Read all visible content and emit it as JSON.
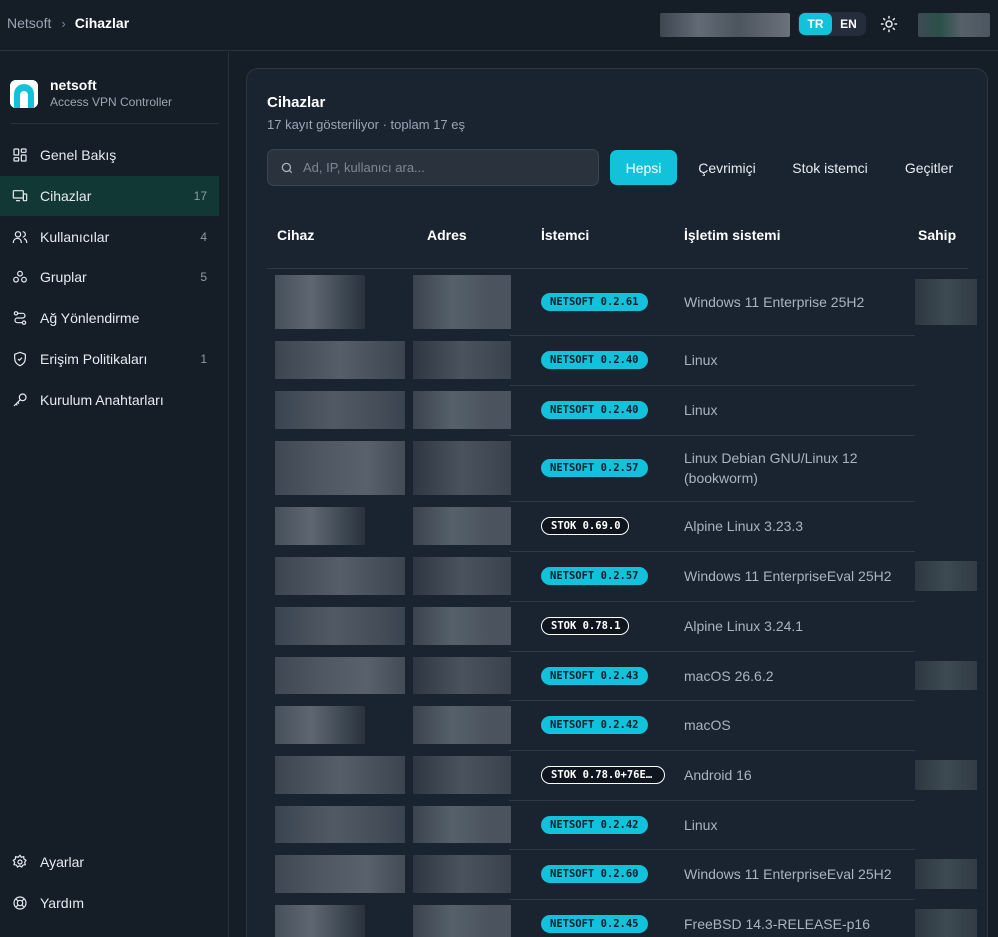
{
  "breadcrumb": {
    "root": "Netsoft",
    "current": "Cihazlar"
  },
  "language": {
    "tr": "TR",
    "en": "EN",
    "active": "TR"
  },
  "brand": {
    "name": "netsoft",
    "subtitle": "Access VPN Controller"
  },
  "nav": [
    {
      "label": "Genel Bakış",
      "count": "",
      "icon": "dashboard-icon"
    },
    {
      "label": "Cihazlar",
      "count": "17",
      "icon": "devices-icon",
      "active": true
    },
    {
      "label": "Kullanıcılar",
      "count": "4",
      "icon": "users-icon"
    },
    {
      "label": "Gruplar",
      "count": "5",
      "icon": "groups-icon"
    },
    {
      "label": "Ağ Yönlendirme",
      "count": "",
      "icon": "routing-icon"
    },
    {
      "label": "Erişim Politikaları",
      "count": "1",
      "icon": "shield-icon"
    },
    {
      "label": "Kurulum Anahtarları",
      "count": "",
      "icon": "key-icon"
    }
  ],
  "nav_bottom": [
    {
      "label": "Ayarlar",
      "icon": "gear-icon"
    },
    {
      "label": "Yardım",
      "icon": "help-icon"
    }
  ],
  "page": {
    "title": "Cihazlar",
    "subtitle": "17 kayıt gösteriliyor · toplam 17 eş",
    "search_placeholder": "Ad, IP, kullanıcı ara...",
    "filters": [
      "Hepsi",
      "Çevrimiçi",
      "Stok istemci",
      "Geçitler"
    ],
    "active_filter": "Hepsi"
  },
  "table": {
    "headers": [
      "Cihaz",
      "Adres",
      "İstemci",
      "İşletim sistemi",
      "Sahip"
    ],
    "rows": [
      {
        "client": "NETSOFT 0.2.61",
        "client_type": "netsoft",
        "os": "Windows 11 Enterprise 25H2"
      },
      {
        "client": "NETSOFT 0.2.40",
        "client_type": "netsoft",
        "os": "Linux"
      },
      {
        "client": "NETSOFT 0.2.40",
        "client_type": "netsoft",
        "os": "Linux"
      },
      {
        "client": "NETSOFT 0.2.57",
        "client_type": "netsoft",
        "os": "Linux Debian GNU/Linux 12",
        "os2": "(bookworm)"
      },
      {
        "client": "STOK 0.69.0",
        "client_type": "stok",
        "os": "Alpine Linux 3.23.3"
      },
      {
        "client": "NETSOFT 0.2.57",
        "client_type": "netsoft",
        "os": "Windows 11 EnterpriseEval 25H2"
      },
      {
        "client": "STOK 0.78.1",
        "client_type": "stok",
        "os": "Alpine Linux 3.24.1"
      },
      {
        "client": "NETSOFT 0.2.43",
        "client_type": "netsoft",
        "os": "macOS 26.6.2"
      },
      {
        "client": "NETSOFT 0.2.42",
        "client_type": "netsoft",
        "os": "macOS"
      },
      {
        "client": "STOK 0.78.0+76E…",
        "client_type": "stok",
        "os": "Android 16"
      },
      {
        "client": "NETSOFT 0.2.42",
        "client_type": "netsoft",
        "os": "Linux"
      },
      {
        "client": "NETSOFT 0.2.60",
        "client_type": "netsoft",
        "os": "Windows 11 EnterpriseEval 25H2"
      },
      {
        "client": "NETSOFT 0.2.45",
        "client_type": "netsoft",
        "os": "FreeBSD 14.3-RELEASE-p16"
      }
    ]
  },
  "colors": {
    "accent": "#12c2db",
    "background": "#151d27",
    "card": "#1a2330",
    "active_nav": "#113834"
  }
}
